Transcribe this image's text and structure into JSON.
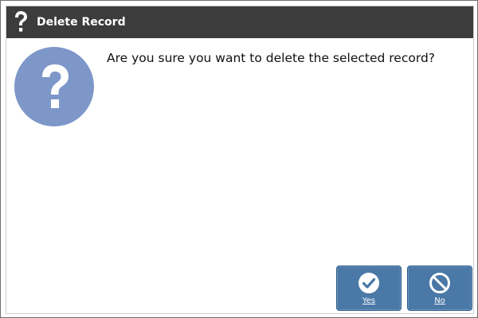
{
  "window": {
    "title": "Delete Record",
    "title_icon": "question-mark-icon"
  },
  "content": {
    "icon": "question-mark-icon",
    "message": "Are you sure you want to delete the selected record?"
  },
  "buttons": {
    "yes": {
      "label": "Yes",
      "icon": "check-circle-icon"
    },
    "no": {
      "label": "No",
      "icon": "no-entry-icon"
    }
  },
  "colors": {
    "titlebar_bg": "#3c3c3c",
    "icon_circle": "#7e97c9",
    "button_bg": "#4a78a7"
  }
}
